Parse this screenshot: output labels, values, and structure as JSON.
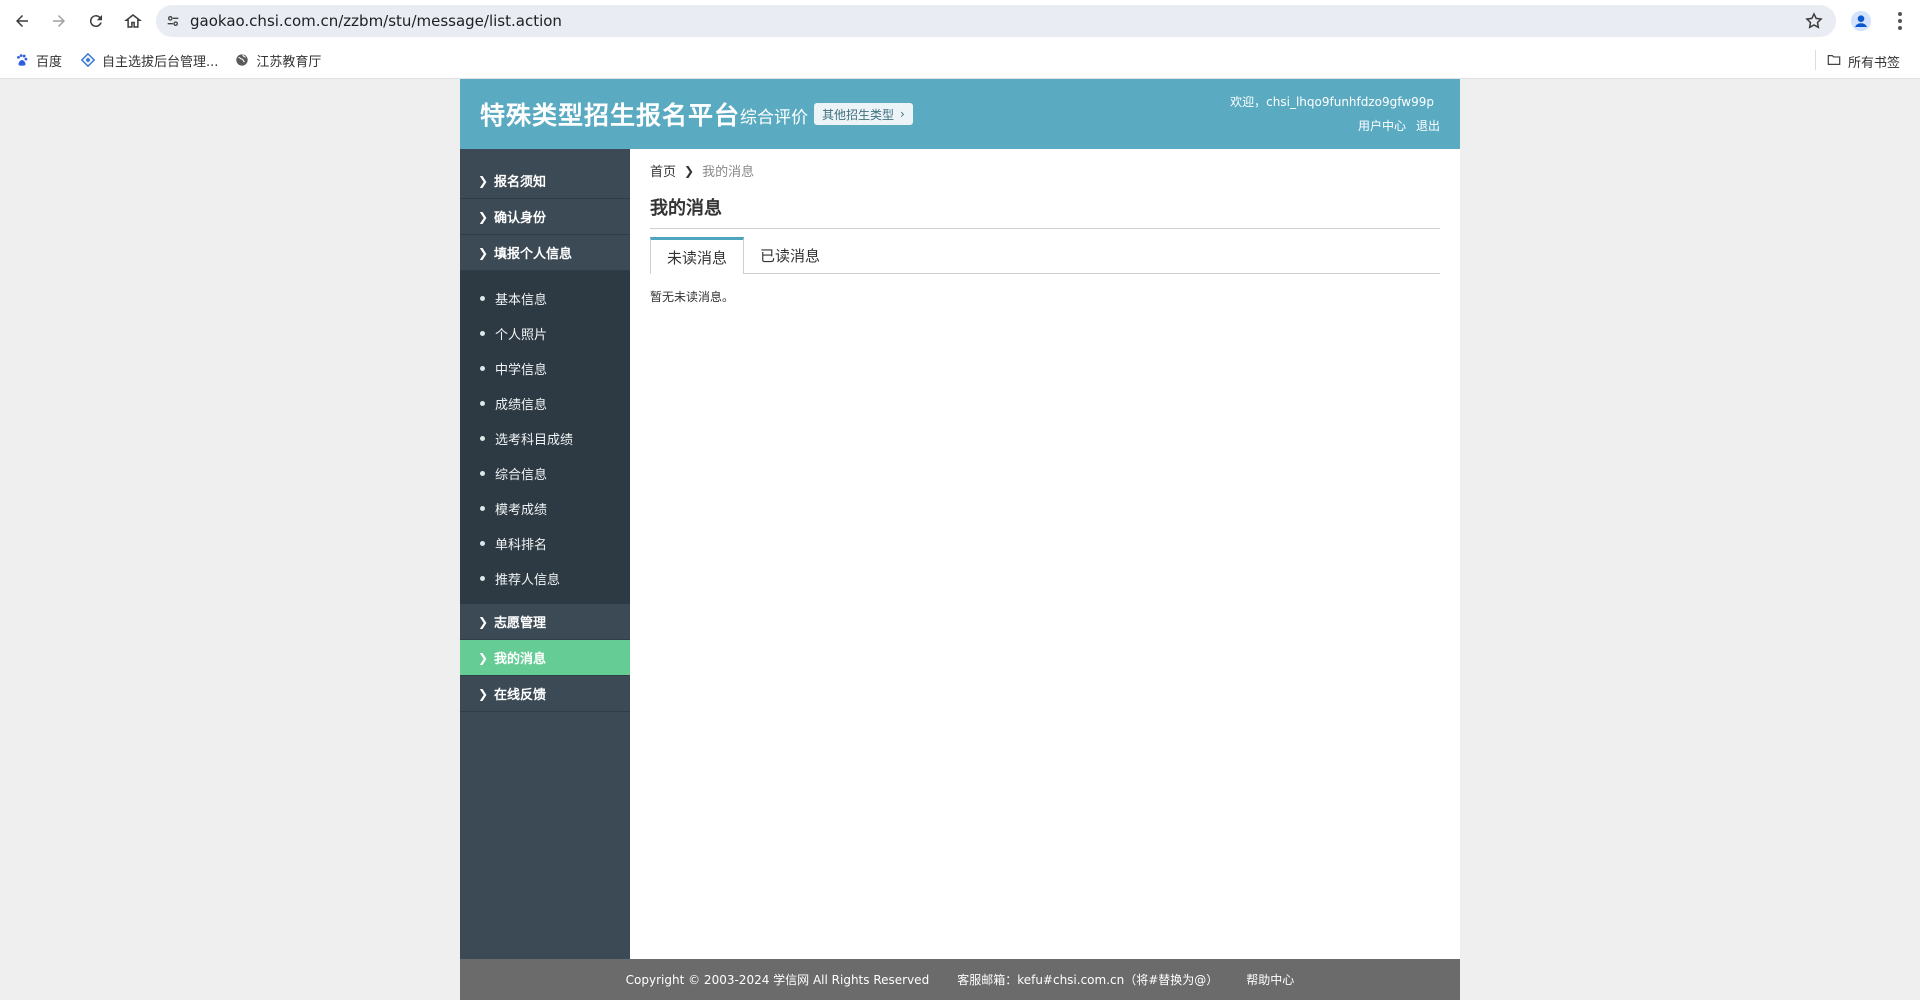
{
  "browser": {
    "url": "gaokao.chsi.com.cn/zzbm/stu/message/list.action",
    "bookmarks": [
      {
        "label": "百度",
        "icon": "baidu-paw-icon"
      },
      {
        "label": "自主选拔后台管理...",
        "icon": "diamond-logo-icon"
      },
      {
        "label": "江苏教育厅",
        "icon": "globe-icon"
      }
    ],
    "all_bookmarks": "所有书签"
  },
  "header": {
    "title": "特殊类型招生报名平台",
    "subtitle": "综合评价",
    "other_type": "其他招生类型",
    "welcome": "欢迎，chsi_lhqo9funhfdzo9gfw99p",
    "user_center": "用户中心",
    "logout": "退出",
    "color": "#5aabc2"
  },
  "sidebar": {
    "top_items": [
      {
        "label": "报名须知"
      },
      {
        "label": "确认身份"
      },
      {
        "label": "填报个人信息"
      }
    ],
    "sub_items": [
      {
        "label": "基本信息"
      },
      {
        "label": "个人照片"
      },
      {
        "label": "中学信息"
      },
      {
        "label": "成绩信息"
      },
      {
        "label": "选考科目成绩"
      },
      {
        "label": "综合信息"
      },
      {
        "label": "模考成绩"
      },
      {
        "label": "单科排名"
      },
      {
        "label": "推荐人信息"
      }
    ],
    "bottom_items": [
      {
        "label": "志愿管理"
      },
      {
        "label": "我的消息",
        "active": true
      },
      {
        "label": "在线反馈"
      }
    ],
    "active_color": "#66cc96"
  },
  "content": {
    "breadcrumb_home": "首页",
    "breadcrumb_current": "我的消息",
    "heading": "我的消息",
    "tabs": [
      {
        "label": "未读消息",
        "active": true
      },
      {
        "label": "已读消息",
        "active": false
      }
    ],
    "empty_message": "暂无未读消息。"
  },
  "footer": {
    "copyright": "Copyright © 2003-2024 学信网 All Rights Reserved",
    "email": "客服邮箱：kefu#chsi.com.cn（将#替换为@）",
    "help": "帮助中心"
  }
}
